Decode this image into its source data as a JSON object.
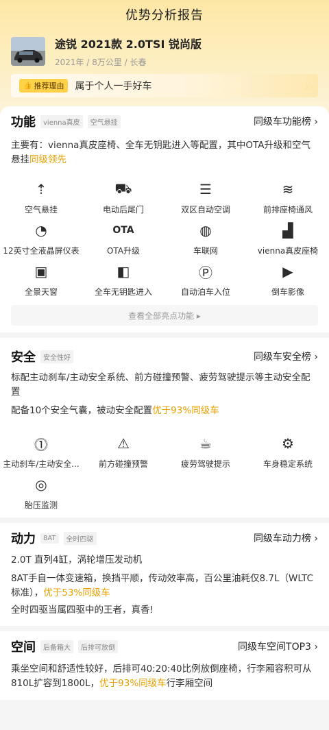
{
  "page_title": "优势分析报告",
  "car": {
    "name": "途锐 2021款 2.0TSI 锐尚版",
    "meta": "2021年 / 8万公里 / 长春"
  },
  "reason": {
    "tag": "推荐理由",
    "text": "属于个人一手好车"
  },
  "features_section": {
    "title": "功能",
    "chips": [
      "vienna真皮",
      "空气悬挂"
    ],
    "rank_link": "同级车功能榜 ›",
    "desc_main": "主要有：vienna真皮座椅、全车无钥匙进入等配置，其中OTA升级和空气悬挂",
    "desc_hl": "同级领先",
    "items": [
      {
        "label": "空气悬挂",
        "icon": "air-suspension-icon",
        "glyph": "⇡"
      },
      {
        "label": "电动后尾门",
        "icon": "power-tailgate-icon",
        "glyph": "⛟"
      },
      {
        "label": "双区自动空调",
        "icon": "dual-zone-ac-icon",
        "glyph": "☰"
      },
      {
        "label": "前排座椅通风",
        "icon": "seat-ventilation-icon",
        "glyph": "≋"
      },
      {
        "label": "12英寸全液晶屏仪表",
        "icon": "lcd-cluster-icon",
        "glyph": "◔"
      },
      {
        "label": "OTA升级",
        "icon": "ota-icon",
        "glyph": "OTA"
      },
      {
        "label": "车联网",
        "icon": "connected-car-icon",
        "glyph": "◍"
      },
      {
        "label": "vienna真皮座椅",
        "icon": "leather-seat-icon",
        "glyph": "▟"
      },
      {
        "label": "全景天窗",
        "icon": "sunroof-icon",
        "glyph": "▣"
      },
      {
        "label": "全车无钥匙进入",
        "icon": "keyless-entry-icon",
        "glyph": "◧"
      },
      {
        "label": "自动泊车入位",
        "icon": "auto-parking-icon",
        "glyph": "Ⓟ"
      },
      {
        "label": "倒车影像",
        "icon": "rear-camera-icon",
        "glyph": "▶"
      }
    ],
    "view_all": "查看全部亮点功能 ▸"
  },
  "safety_section": {
    "title": "安全",
    "chips": [
      "安全性好"
    ],
    "rank_link": "同级车安全榜 ›",
    "desc1": "标配主动刹车/主动安全系统、前方碰撞预警、疲劳驾驶提示等主动安全配置",
    "desc2_main": "配备10个安全气囊，被动安全配置",
    "desc2_hl": "优于93%同级车",
    "items": [
      {
        "label": "主动刹车/主动安全...",
        "icon": "active-brake-icon",
        "glyph": "⓵"
      },
      {
        "label": "前方碰撞预警",
        "icon": "collision-warning-icon",
        "glyph": "⚠"
      },
      {
        "label": "疲劳驾驶提示",
        "icon": "fatigue-alert-icon",
        "glyph": "☕"
      },
      {
        "label": "车身稳定系统",
        "icon": "stability-control-icon",
        "glyph": "⚙"
      },
      {
        "label": "胎压监测",
        "icon": "tire-pressure-icon",
        "glyph": "◎"
      }
    ]
  },
  "power_section": {
    "title": "动力",
    "chips": [
      "8AT",
      "全时四驱"
    ],
    "rank_link": "同级车动力榜 ›",
    "line1": "2.0T 直列4缸，涡轮增压发动机",
    "line2_main": "8AT手自一体变速箱，换挡平顺，传动效率高，百公里油耗仅8.7L（WLTC标准），",
    "line2_hl": "优于53%同级车",
    "line3": "全时四驱当属四驱中的王者，真香!"
  },
  "space_section": {
    "title": "空间",
    "chips": [
      "后备箱大",
      "后排可放倒"
    ],
    "rank_link": "同级车空间TOP3 ›",
    "line_main": "乘坐空间和舒适性较好，后排可40:20:40比例放倒座椅，行李厢容积可从810L扩容到1800L，",
    "line_hl": "优于93%同级车",
    "line_tail": "行李厢空间"
  }
}
